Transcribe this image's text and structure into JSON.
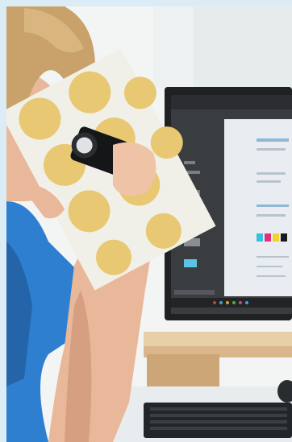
{
  "scene": {
    "colors": {
      "background": "#f2f4f4",
      "shirt": "#2f7fd0",
      "hair": "#c8a26a",
      "skin": "#e9b89a",
      "sheet": "#f1f0e8",
      "dots": "#e8c872",
      "monitor_bezel": "#1f2123",
      "screen_dark": "#3a3d40",
      "document": "#e9edf1",
      "desk": "#e8d2b0",
      "keyboard": "#232629"
    },
    "swatches": [
      "#34c1e0",
      "#e0307a",
      "#f2d22e",
      "#1a1a1a"
    ]
  }
}
